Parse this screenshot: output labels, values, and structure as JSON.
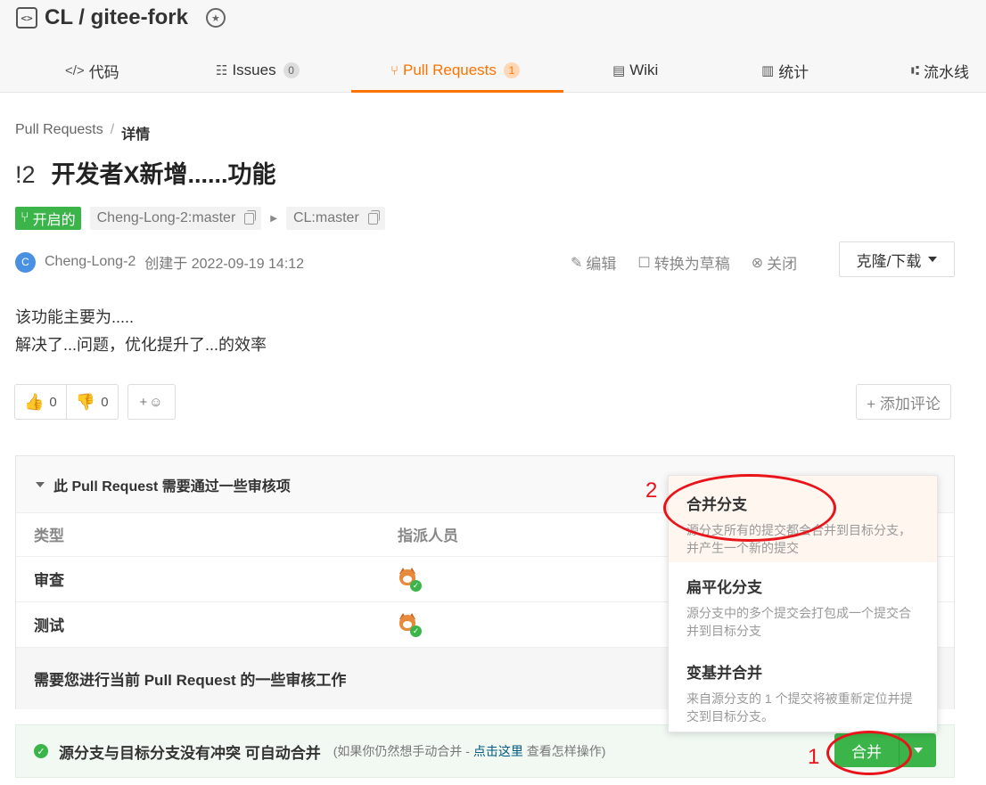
{
  "repo": {
    "title": "CL / gitee-fork"
  },
  "tabs": [
    {
      "label": "代码",
      "icon": "</>"
    },
    {
      "label": "Issues",
      "count": "0"
    },
    {
      "label": "Pull Requests",
      "count": "1"
    },
    {
      "label": "Wiki"
    },
    {
      "label": "统计"
    },
    {
      "label": "流水线"
    }
  ],
  "breadcrumb": {
    "parent": "Pull Requests",
    "sep": "/",
    "current": "详情"
  },
  "pr": {
    "number": "!2",
    "title": "开发者X新增......功能",
    "status": "开启的",
    "source_branch": "Cheng-Long-2:master",
    "target_branch": "CL:master",
    "author": "Cheng-Long-2",
    "avatar_letter": "C",
    "created": "创建于 2022-09-19 14:12",
    "description": [
      "该功能主要为.....",
      "解决了...问题，优化提升了...的效率"
    ]
  },
  "actions": {
    "edit": "编辑",
    "draft": "转换为草稿",
    "close": "关闭",
    "clone": "克隆/下载"
  },
  "reactions": {
    "like_count": "0",
    "dislike_count": "0",
    "add_emoji": "+",
    "add_comment": "+ 添加评论"
  },
  "review": {
    "heading": "此 Pull Request 需要通过一些审核项",
    "columns": [
      "类型",
      "指派人员"
    ],
    "rows": [
      {
        "type": "审查"
      },
      {
        "type": "测试"
      }
    ],
    "footer": "需要您进行当前 Pull Request 的一些审核工作"
  },
  "merge": {
    "message": "源分支与目标分支没有冲突 可自动合并",
    "hint_prefix": "(如果你仍然想手动合并 - ",
    "hint_link": "点击这里",
    "hint_suffix": " 查看怎样操作)",
    "button": "合并"
  },
  "merge_menu": [
    {
      "title": "合并分支",
      "desc": "源分支所有的提交都会合并到目标分支，并产生一个新的提交"
    },
    {
      "title": "扁平化分支",
      "desc": "源分支中的多个提交会打包成一个提交合并到目标分支"
    },
    {
      "title": "变基并合并",
      "desc": "来自源分支的 1 个提交将被重新定位并提交到目标分支。"
    }
  ],
  "annotations": {
    "num1": "1",
    "num2": "2",
    "color": "#e8141a"
  },
  "colors": {
    "accent": "#fe7300",
    "success": "#3bb54a",
    "link": "#005980"
  }
}
